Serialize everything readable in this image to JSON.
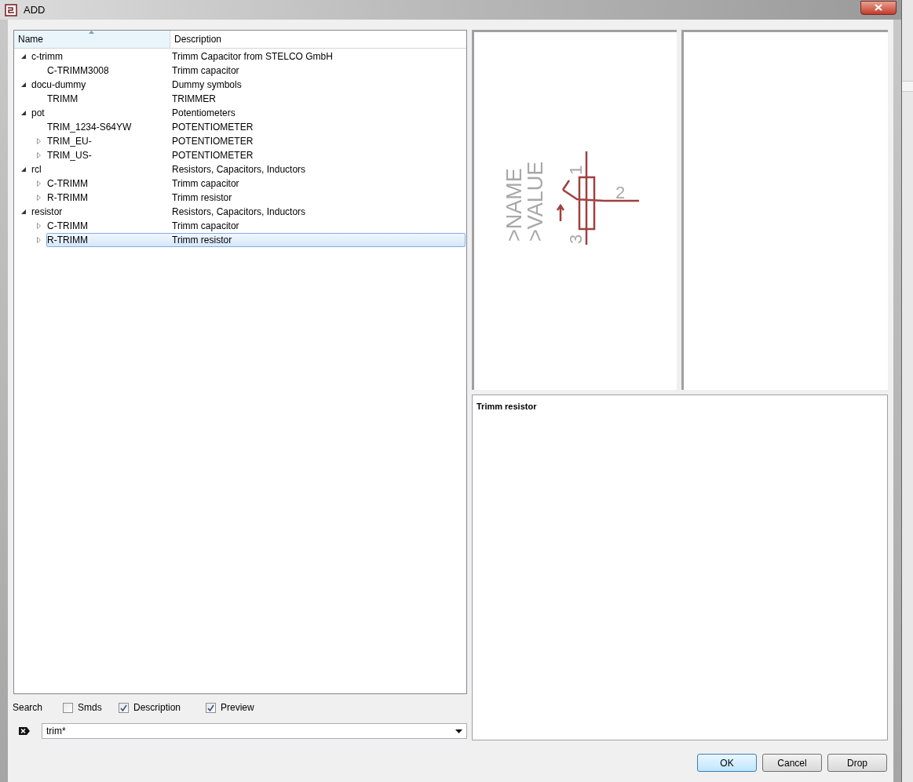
{
  "window": {
    "title": "ADD"
  },
  "tree": {
    "columns": [
      {
        "label": "Name",
        "sorted": true
      },
      {
        "label": "Description",
        "sorted": false
      }
    ],
    "rows": [
      {
        "name": "c-trimm",
        "description": "Trimm Capacitor from STELCO GmbH",
        "expandable": true,
        "expanded": true,
        "selected": false,
        "children": [
          {
            "name": "C-TRIMM3008",
            "description": "Trimm capacitor",
            "expandable": false,
            "selected": false
          }
        ]
      },
      {
        "name": "docu-dummy",
        "description": "Dummy symbols",
        "expandable": true,
        "expanded": true,
        "selected": false,
        "children": [
          {
            "name": "TRIMM",
            "description": "TRIMMER",
            "expandable": false,
            "selected": false
          }
        ]
      },
      {
        "name": "pot",
        "description": "Potentiometers",
        "expandable": true,
        "expanded": true,
        "selected": false,
        "children": [
          {
            "name": "TRIM_1234-S64YW",
            "description": "POTENTIOMETER",
            "expandable": false,
            "selected": false
          },
          {
            "name": "TRIM_EU-",
            "description": "POTENTIOMETER",
            "expandable": true,
            "expanded": false,
            "selected": false
          },
          {
            "name": "TRIM_US-",
            "description": "POTENTIOMETER",
            "expandable": true,
            "expanded": false,
            "selected": false
          }
        ]
      },
      {
        "name": "rcl",
        "description": "Resistors, Capacitors, Inductors",
        "expandable": true,
        "expanded": true,
        "selected": false,
        "children": [
          {
            "name": "C-TRIMM",
            "description": "Trimm capacitor",
            "expandable": true,
            "expanded": false,
            "selected": false
          },
          {
            "name": "R-TRIMM",
            "description": "Trimm resistor",
            "expandable": true,
            "expanded": false,
            "selected": false
          }
        ]
      },
      {
        "name": "resistor",
        "description": "Resistors, Capacitors, Inductors",
        "expandable": true,
        "expanded": true,
        "selected": false,
        "children": [
          {
            "name": "C-TRIMM",
            "description": "Trimm capacitor",
            "expandable": true,
            "expanded": false,
            "selected": false
          },
          {
            "name": "R-TRIMM",
            "description": "Trimm resistor",
            "expandable": true,
            "expanded": false,
            "selected": true
          }
        ]
      }
    ]
  },
  "symbol_preview": {
    "labels": [
      ">NAME",
      ">VALUE"
    ],
    "pins": [
      "1",
      "2",
      "3"
    ]
  },
  "description_panel": {
    "text": "Trimm resistor"
  },
  "search": {
    "label": "Search",
    "options": [
      {
        "label": "Smds",
        "checked": false
      },
      {
        "label": "Description",
        "checked": true
      },
      {
        "label": "Preview",
        "checked": true
      }
    ],
    "value": "trim*"
  },
  "buttons": [
    {
      "label": "OK",
      "default": true
    },
    {
      "label": "Cancel",
      "default": false
    },
    {
      "label": "Drop",
      "default": false
    }
  ]
}
